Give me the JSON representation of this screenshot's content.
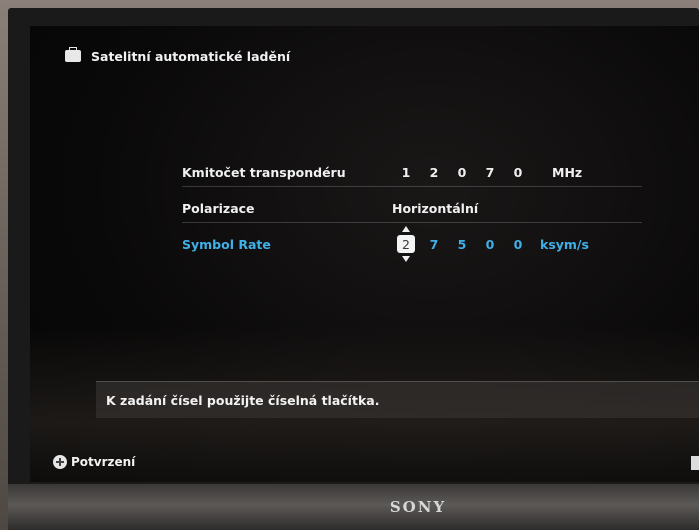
{
  "header": {
    "title": "Satelitní automatické ladění",
    "icon": "tv-tuner-icon"
  },
  "form": {
    "rows": [
      {
        "label": "Kmitočet transpondéru",
        "digits": [
          "1",
          "2",
          "0",
          "7",
          "0"
        ],
        "unit": "MHz"
      },
      {
        "label": "Polarizace",
        "value": "Horizontální"
      },
      {
        "label": "Symbol Rate",
        "digits": [
          "2",
          "7",
          "5",
          "0",
          "0"
        ],
        "unit": "ksym/s",
        "active": true,
        "selected_digit_index": 0
      }
    ]
  },
  "hint": {
    "text": "K zadání čísel použijte číselná tlačítka."
  },
  "footer": {
    "confirm_label": "Potvrzení",
    "icon": "navigation-pad-icon"
  },
  "device": {
    "brand": "SONY"
  },
  "colors": {
    "active": "#3fb0e8",
    "text": "#f0f0f0",
    "screen_bg": "#0a0909"
  }
}
